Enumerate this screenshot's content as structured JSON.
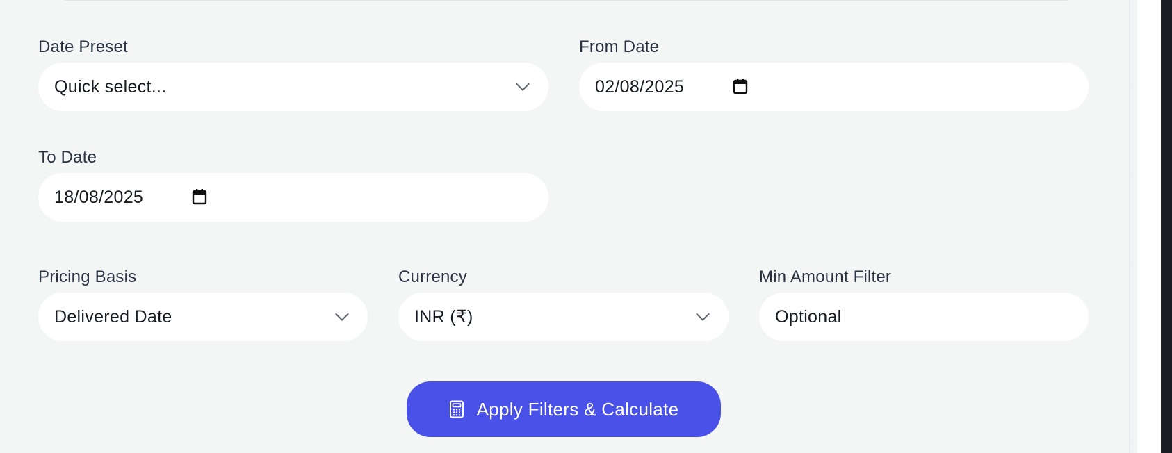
{
  "filters": {
    "date_preset": {
      "label": "Date Preset",
      "selected": "Quick select..."
    },
    "from_date": {
      "label": "From Date",
      "value": "02/08/2025"
    },
    "to_date": {
      "label": "To Date",
      "value": "18/08/2025"
    },
    "pricing_basis": {
      "label": "Pricing Basis",
      "selected": "Delivered Date"
    },
    "currency": {
      "label": "Currency",
      "selected": "INR (₹)"
    },
    "min_amount": {
      "label": "Min Amount Filter",
      "placeholder": "Optional"
    }
  },
  "actions": {
    "apply_label": "Apply Filters & Calculate",
    "apply_icon": "calculator-icon"
  },
  "icons": {
    "dropdown": "chevron-down-icon",
    "date": "calendar-icon"
  },
  "colors": {
    "background": "#f4f6f6",
    "field_bg": "#ffffff",
    "primary_button": "#4a51e8",
    "label_text": "#2a3342"
  }
}
